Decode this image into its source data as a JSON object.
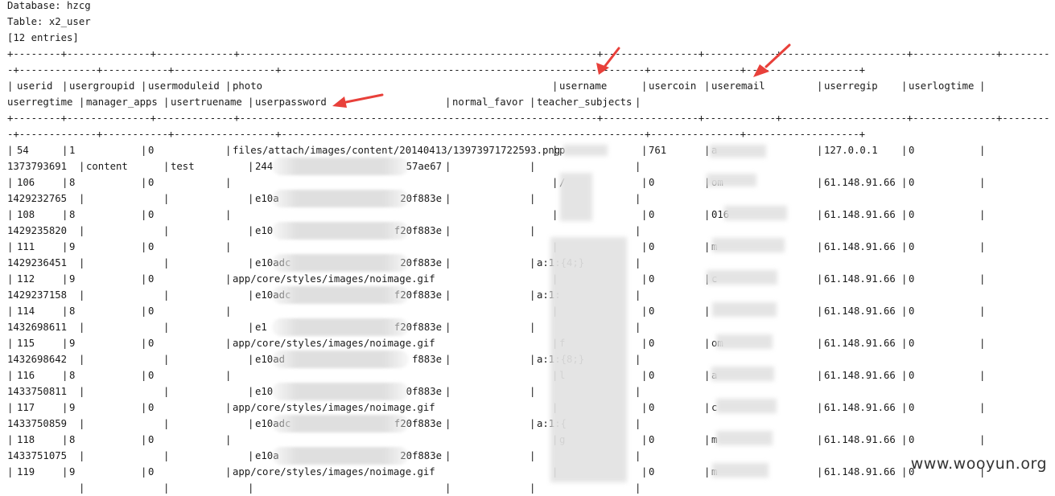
{
  "meta": {
    "database_line": "Database: hzcg",
    "table_line": "Table: x2_user",
    "entries_line": "[12 entries]"
  },
  "rule_line_1": "+--------+--------------+-------------+------------------------------------------------------------+----------------+------------+---------------------+--------------+--------------+---------------------+",
  "rule_line_2": "-+-------------+-----------+-----------------+-------------------------------------------------------------+---------------+-------------------+",
  "header": {
    "line1": [
      "userid",
      "usergroupid",
      "usermoduleid",
      "photo",
      "username",
      "usercoin",
      "useremail",
      "userregip",
      "userlogtime"
    ],
    "line2": [
      "userregtime",
      "manager_apps",
      "usertruename",
      "userpassword",
      "normal_favor",
      "teacher_subjects"
    ]
  },
  "rows": [
    {
      "userid": "54",
      "usergroupid": "1",
      "usermoduleid": "0",
      "photo": "files/attach/images/content/20140413/13973971722593.png",
      "username": "p",
      "usercoin": "761",
      "useremail": "a",
      "userregip": "127.0.0.1",
      "userlogtime": "0",
      "userregtime": "1373793691",
      "manager_apps": "content",
      "usertruename": "test",
      "userpassword_start": "244",
      "userpassword_end": "57ae67",
      "normal_favor": "",
      "teacher_subjects": ""
    },
    {
      "userid": "106",
      "usergroupid": "8",
      "usermoduleid": "0",
      "photo": "",
      "username": "/",
      "usercoin": "0",
      "useremail": "om",
      "userregip": "61.148.91.66",
      "userlogtime": "0",
      "userregtime": "1429232765",
      "manager_apps": "",
      "usertruename": "",
      "userpassword_start": "e10a",
      "userpassword_end": "20f883e",
      "normal_favor": "",
      "teacher_subjects": ""
    },
    {
      "userid": "108",
      "usergroupid": "8",
      "usermoduleid": "0",
      "photo": "",
      "username": "",
      "usercoin": "0",
      "useremail": "016",
      "userregip": "61.148.91.66",
      "userlogtime": "0",
      "userregtime": "1429235820",
      "manager_apps": "",
      "usertruename": "",
      "userpassword_start": "e10",
      "userpassword_end": "f20f883e",
      "normal_favor": "",
      "teacher_subjects": ""
    },
    {
      "userid": "111",
      "usergroupid": "9",
      "usermoduleid": "0",
      "photo": "",
      "username": "",
      "usercoin": "0",
      "useremail": "m",
      "userregip": "61.148.91.66",
      "userlogtime": "0",
      "userregtime": "1429236451",
      "manager_apps": "",
      "usertruename": "",
      "userpassword_start": "e10adc",
      "userpassword_end": "20f883e",
      "normal_favor": "",
      "teacher_subjects": "a:1:{4;}"
    },
    {
      "userid": "112",
      "usergroupid": "9",
      "usermoduleid": "0",
      "photo": "app/core/styles/images/noimage.gif",
      "username": "",
      "usercoin": "0",
      "useremail": "c",
      "userregip": "61.148.91.66",
      "userlogtime": "0",
      "userregtime": "1429237158",
      "manager_apps": "",
      "usertruename": "",
      "userpassword_start": "e10adc",
      "userpassword_end": "f20f883e",
      "normal_favor": "",
      "teacher_subjects": "a:1:"
    },
    {
      "userid": "114",
      "usergroupid": "8",
      "usermoduleid": "0",
      "photo": "",
      "username": "",
      "usercoin": "0",
      "useremail": "",
      "userregip": "61.148.91.66",
      "userlogtime": "0",
      "userregtime": "1432698611",
      "manager_apps": "",
      "usertruename": "",
      "userpassword_start": "e1",
      "userpassword_end": "f20f883e",
      "normal_favor": "",
      "teacher_subjects": ""
    },
    {
      "userid": "115",
      "usergroupid": "9",
      "usermoduleid": "0",
      "photo": "app/core/styles/images/noimage.gif",
      "username": "f",
      "usercoin": "0",
      "useremail": "om",
      "userregip": "61.148.91.66",
      "userlogtime": "0",
      "userregtime": "1432698642",
      "manager_apps": "",
      "usertruename": "",
      "userpassword_start": "e10ad",
      "userpassword_end": "f883e",
      "normal_favor": "",
      "teacher_subjects": "a:1:{8;}"
    },
    {
      "userid": "116",
      "usergroupid": "8",
      "usermoduleid": "0",
      "photo": "",
      "username": "l",
      "usercoin": "0",
      "useremail": "a",
      "userregip": "61.148.91.66",
      "userlogtime": "0",
      "userregtime": "1433750811",
      "manager_apps": "",
      "usertruename": "",
      "userpassword_start": "e10",
      "userpassword_end": "0f883e",
      "normal_favor": "",
      "teacher_subjects": ""
    },
    {
      "userid": "117",
      "usergroupid": "9",
      "usermoduleid": "0",
      "photo": "app/core/styles/images/noimage.gif",
      "username": "",
      "usercoin": "0",
      "useremail": "c",
      "userregip": "61.148.91.66",
      "userlogtime": "0",
      "userregtime": "1433750859",
      "manager_apps": "",
      "usertruename": "",
      "userpassword_start": "e10adc",
      "userpassword_end": "f20f883e",
      "normal_favor": "",
      "teacher_subjects": "a:1:{"
    },
    {
      "userid": "118",
      "usergroupid": "8",
      "usermoduleid": "0",
      "photo": "",
      "username": "g",
      "usercoin": "0",
      "useremail": "m",
      "userregip": "61.148.91.66",
      "userlogtime": "0",
      "userregtime": "1433751075",
      "manager_apps": "",
      "usertruename": "",
      "userpassword_start": "e10a",
      "userpassword_end": "20f883e",
      "normal_favor": "",
      "teacher_subjects": ""
    },
    {
      "userid": "119",
      "usergroupid": "9",
      "usermoduleid": "0",
      "photo": "app/core/styles/images/noimage.gif",
      "username": "",
      "usercoin": "0",
      "useremail": "m",
      "userregip": "61.148.91.66",
      "userlogtime": "0",
      "userregtime": "",
      "manager_apps": "",
      "usertruename": "",
      "userpassword_start": "",
      "userpassword_end": "",
      "normal_favor": "",
      "teacher_subjects": ""
    }
  ],
  "watermark": "www.wooyun.org",
  "colors": {
    "arrow": "#e8403a",
    "text": "#1a1a1a",
    "redaction": "#e0e0e0"
  }
}
